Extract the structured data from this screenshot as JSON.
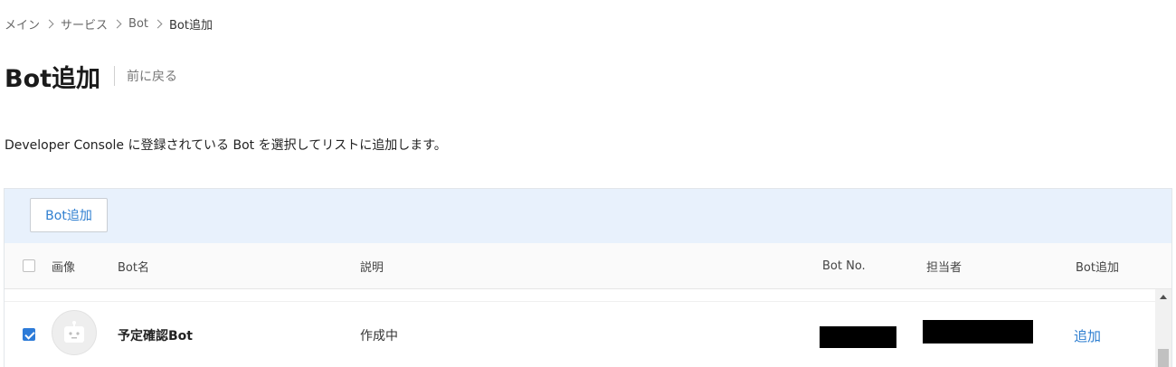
{
  "breadcrumb": [
    "メイン",
    "サービス",
    "Bot",
    "Bot追加"
  ],
  "page": {
    "title": "Bot追加",
    "back_label": "前に戻る",
    "description": "Developer Console に登録されている Bot を選択してリストに追加します。"
  },
  "toolbar": {
    "add_button_label": "Bot追加"
  },
  "table": {
    "columns": {
      "image": "画像",
      "name": "Bot名",
      "description": "説明",
      "bot_no": "Bot No.",
      "owner": "担当者",
      "add": "Bot追加"
    },
    "rows": [
      {
        "checked": true,
        "avatar_icon": "robot-icon",
        "name": "予定確認Bot",
        "description": "作成中",
        "bot_no": "",
        "owner": "",
        "action_label": "追加"
      }
    ]
  },
  "colors": {
    "accent": "#2f7fd0",
    "toolbar_bg": "#e8f1fc",
    "checkbox_checked": "#2d7bd8"
  }
}
